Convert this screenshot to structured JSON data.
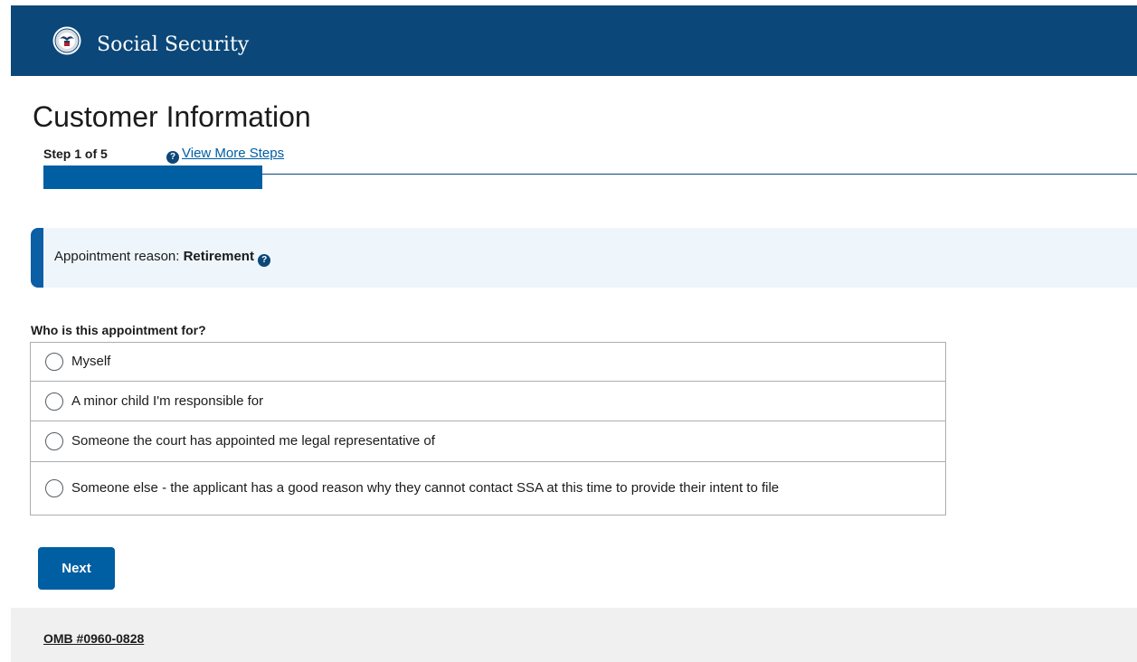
{
  "header": {
    "brand": "Social Security",
    "seal_icon": "ssa-seal-icon",
    "background_color": "#0b4778"
  },
  "page": {
    "title": "Customer Information",
    "step_label": "Step 1 of 5",
    "view_steps_link": "View More Steps",
    "help_icon_glyph": "?",
    "progress_percent": 20,
    "accent_color": "#005ea2"
  },
  "alert": {
    "prefix": "Appointment reason:",
    "value": "Retirement",
    "help_icon_glyph": "?"
  },
  "form": {
    "question": "Who is this appointment for?",
    "options": [
      {
        "label": "Myself",
        "selected": false
      },
      {
        "label": "A minor child I'm responsible for",
        "selected": false
      },
      {
        "label": "Someone the court has appointed me legal representative of",
        "selected": false
      },
      {
        "label": "Someone else - the applicant has a good reason why they cannot contact SSA at this time to provide their intent to file",
        "selected": false
      }
    ],
    "next_label": "Next"
  },
  "footer": {
    "omb_label": "OMB #0960-0828"
  }
}
